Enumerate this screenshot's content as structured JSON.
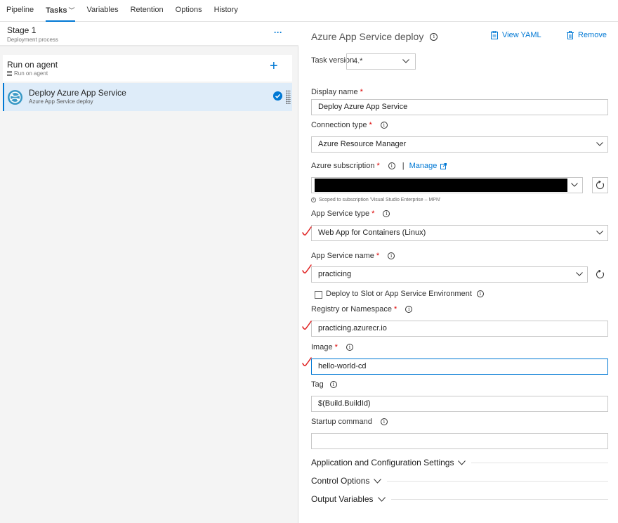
{
  "nav": {
    "tabs": [
      {
        "label": "Pipeline"
      },
      {
        "label": "Tasks"
      },
      {
        "label": "Variables"
      },
      {
        "label": "Retention"
      },
      {
        "label": "Options"
      },
      {
        "label": "History"
      }
    ],
    "active": "Tasks"
  },
  "stage": {
    "title": "Stage 1",
    "subtitle": "Deployment process",
    "more": "···"
  },
  "agent": {
    "title": "Run on agent",
    "subtitle": "Run on agent",
    "add": "+"
  },
  "task": {
    "title": "Deploy Azure App Service",
    "subtitle": "Azure App Service deploy"
  },
  "panel": {
    "title": "Azure App Service deploy",
    "view_yaml": "View YAML",
    "remove": "Remove",
    "task_version_label": "Task version",
    "task_version": "4.*",
    "display_name_label": "Display name",
    "display_name": "Deploy Azure App Service",
    "connection_type_label": "Connection type",
    "connection_type": "Azure Resource Manager",
    "subscription_label": "Azure subscription",
    "manage": "Manage",
    "scope_hint": "Scoped to subscription 'Visual Studio Enterprise – MPN'",
    "app_type_label": "App Service type",
    "app_type": "Web App for Containers (Linux)",
    "app_name_label": "App Service name",
    "app_name": "practicing",
    "slot_label": "Deploy to Slot or App Service Environment",
    "registry_label": "Registry or Namespace",
    "registry": "practicing.azurecr.io",
    "image_label": "Image",
    "image": "hello-world-cd",
    "tag_label": "Tag",
    "tag": "$(Build.BuildId)",
    "startup_label": "Startup command",
    "startup": "",
    "required": "*",
    "sep": "|",
    "sections": [
      {
        "label": "Application and Configuration Settings"
      },
      {
        "label": "Control Options"
      },
      {
        "label": "Output Variables"
      }
    ]
  },
  "colors": {
    "accent": "#0078d4",
    "required": "#dd0000",
    "annotation": "#e02020"
  }
}
